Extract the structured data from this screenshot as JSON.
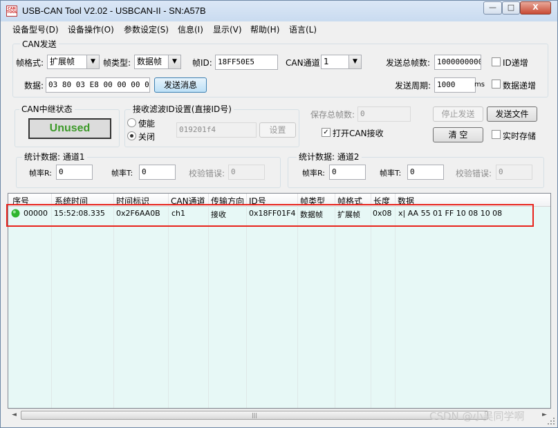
{
  "window": {
    "title": "USB-CAN Tool V2.02 - USBCAN-II - SN:A57B",
    "icon_text": "CAN TOOL",
    "controls": {
      "minimize": "—",
      "maximize": "□",
      "close": "X"
    }
  },
  "menu": [
    "设备型号(D)",
    "设备操作(O)",
    "参数设定(S)",
    "信息(I)",
    "显示(V)",
    "帮助(H)",
    "语言(L)"
  ],
  "can_send": {
    "group_title": "CAN发送",
    "frame_format_label": "帧格式:",
    "frame_format_value": "扩展帧",
    "frame_type_label": "帧类型:",
    "frame_type_value": "数据帧",
    "frame_id_label": "帧ID:",
    "frame_id_value": "18FF50E5",
    "can_channel_label": "CAN通道:",
    "can_channel_value": "1",
    "total_frames_label": "发送总帧数:",
    "total_frames_value": "1000000000",
    "id_increment_label": "ID递增",
    "data_label": "数据:",
    "data_value": "03 80 03 E8 00 00 00 00",
    "send_button": "发送消息",
    "send_period_label": "发送周期:",
    "send_period_value": "1000",
    "send_period_unit": "ms",
    "data_increment_label": "数据递增"
  },
  "relay": {
    "group_title": "CAN中继状态",
    "status": "Unused"
  },
  "filter": {
    "group_title": "接收滤波ID设置(直接ID号)",
    "enable_label": "使能",
    "disable_label": "关闭",
    "selected": "关闭",
    "id_value": "019201f4",
    "set_button": "设置"
  },
  "controls": {
    "saved_frames_label": "保存总帧数:",
    "saved_frames_value": "0",
    "stop_send_button": "停止发送",
    "send_file_button": "发送文件",
    "open_can_receive_label": "打开CAN接收",
    "open_can_receive_checked": true,
    "clear_button": "清 空",
    "realtime_save_label": "实时存储"
  },
  "stats": [
    {
      "title": "统计数据: 通道1",
      "rate_r_label": "帧率R:",
      "rate_r": "0",
      "rate_t_label": "帧率T:",
      "rate_t": "0",
      "err_label": "校验错误:",
      "err": "0"
    },
    {
      "title": "统计数据: 通道2",
      "rate_r_label": "帧率R:",
      "rate_r": "0",
      "rate_t_label": "帧率T:",
      "rate_t": "0",
      "err_label": "校验错误:",
      "err": "0"
    }
  ],
  "table": {
    "headers": [
      "序号",
      "系统时间",
      "时间标识",
      "CAN通道",
      "传输方向",
      "ID号",
      "帧类型",
      "帧格式",
      "长度",
      "数据"
    ],
    "rows": [
      [
        "00000",
        "15:52:08.335",
        "0x2F6AA0B",
        "ch1",
        "接收",
        "0x18FF01F4",
        "数据帧",
        "扩展帧",
        "0x08",
        "x| AA 55 01 FF 10 08 10 08"
      ]
    ]
  },
  "scrollbar": {
    "left": "◄",
    "right": "►",
    "thumb": "|||"
  },
  "watermark": "CSDN @小吴同学啊",
  "colors": {
    "status_ok": "#3d9a2a",
    "highlight": "#e8221a",
    "list_bg": "#e7f8f6",
    "row_dot": "#2fb52f"
  }
}
